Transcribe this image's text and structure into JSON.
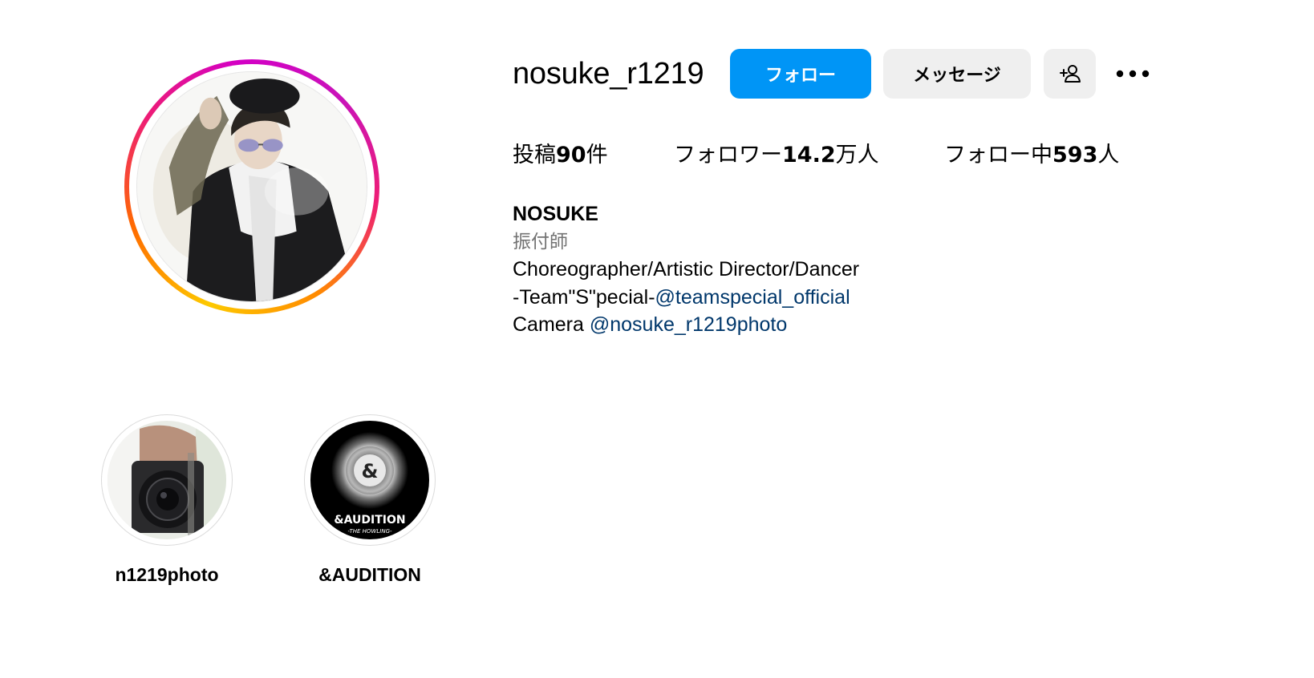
{
  "profile": {
    "username": "nosuke_r1219",
    "actions": {
      "follow_label": "フォロー",
      "message_label": "メッセージ",
      "suggest_icon": "add-person-icon",
      "more_icon": "more-options-icon"
    },
    "stats": {
      "posts_prefix": "投稿",
      "posts_count": "90",
      "posts_suffix": "件",
      "followers_prefix": "フォロワー",
      "followers_count": "14.2",
      "followers_suffix": "万人",
      "following_prefix": "フォロー中",
      "following_count": "593",
      "following_suffix": "人"
    },
    "bio": {
      "full_name": "NOSUKE",
      "category": "振付師",
      "line1": "Choreographer/Artistic Director/Dancer",
      "line2_text": "-Team\"S\"pecial-",
      "line2_mention": "@teamspecial_official",
      "line3_text": "Camera ",
      "line3_mention": "@nosuke_r1219photo"
    }
  },
  "highlights": [
    {
      "label": "n1219photo"
    },
    {
      "label": "&AUDITION",
      "cover_text": "&AUDITION",
      "cover_subtext": "-THE HOWLING-",
      "cover_symbol": "&"
    }
  ],
  "colors": {
    "follow_button": "#0095f6",
    "secondary_button": "#efefef",
    "mention_link": "#00376b",
    "category_text": "#737373",
    "story_ring_gradient": [
      "#fdc900",
      "#ff6a00",
      "#ee1d74",
      "#d300c5"
    ]
  }
}
